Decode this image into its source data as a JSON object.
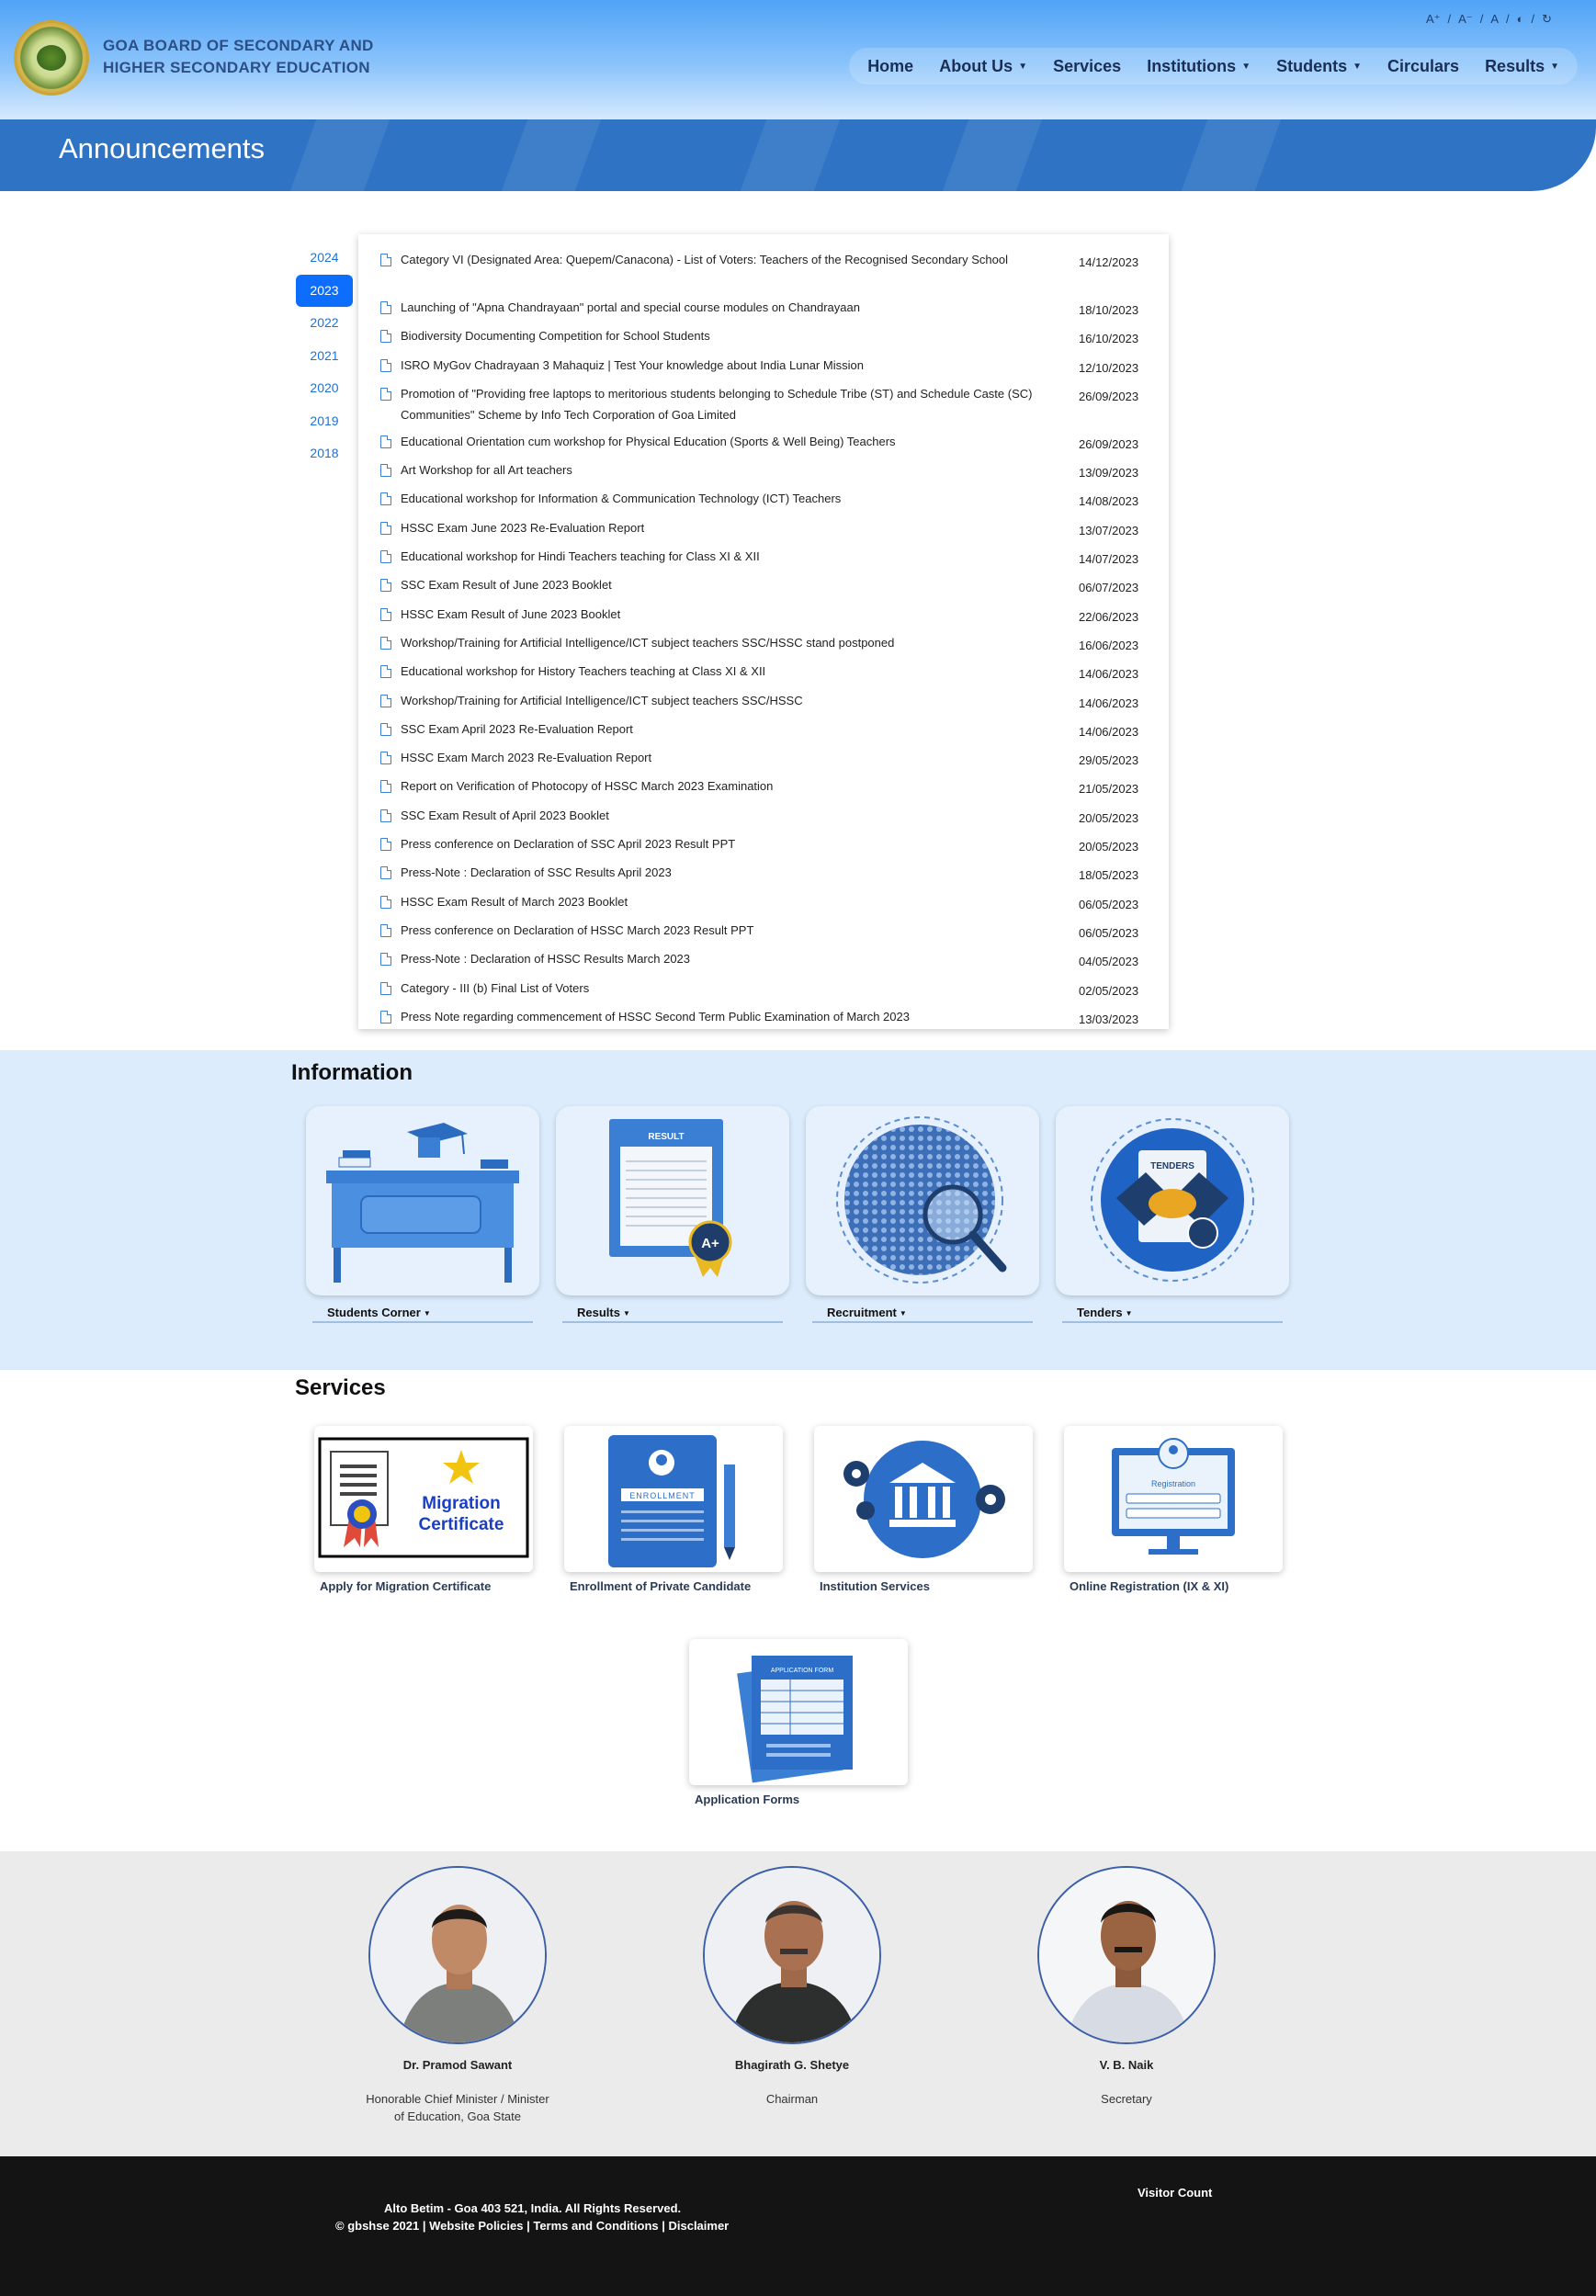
{
  "header": {
    "org_name_line1": "GOA BOARD OF SECONDARY AND",
    "org_name_line2": "HIGHER SECONDARY EDUCATION",
    "a11y": [
      "A⁺",
      "/",
      "A⁻",
      "/",
      "A",
      "/",
      "◐",
      "/",
      "↻"
    ],
    "nav": [
      {
        "label": "Home",
        "dropdown": false
      },
      {
        "label": "About Us",
        "dropdown": true
      },
      {
        "label": "Services",
        "dropdown": false
      },
      {
        "label": "Institutions",
        "dropdown": true
      },
      {
        "label": "Students",
        "dropdown": true
      },
      {
        "label": "Circulars",
        "dropdown": false
      },
      {
        "label": "Results",
        "dropdown": true
      }
    ]
  },
  "banner": {
    "title": "Announcements"
  },
  "years": [
    "2024",
    "2023",
    "2022",
    "2021",
    "2020",
    "2019",
    "2018"
  ],
  "active_year": "2023",
  "announcements": [
    {
      "text": "Category VI (Designated Area: Quepem/Canacona) - List of Voters: Teachers of the Recognised Secondary School",
      "date": "14/12/2023"
    },
    {
      "text": "Launching of \"Apna Chandrayaan\" portal and special course modules on Chandrayaan",
      "date": "18/10/2023"
    },
    {
      "text": "Biodiversity Documenting Competition for School Students",
      "date": "16/10/2023"
    },
    {
      "text": "ISRO MyGov Chadrayaan 3 Mahaquiz | Test Your knowledge about India Lunar Mission",
      "date": "12/10/2023"
    },
    {
      "text": "Promotion of \"Providing free laptops to meritorious students belonging to Schedule Tribe (ST) and Schedule Caste (SC) Communities\" Scheme by Info Tech Corporation of Goa Limited",
      "date": "26/09/2023"
    },
    {
      "text": "Educational Orientation cum workshop for Physical Education (Sports & Well Being) Teachers",
      "date": "26/09/2023"
    },
    {
      "text": "Art Workshop for all Art teachers",
      "date": "13/09/2023"
    },
    {
      "text": "Educational workshop for Information & Communication Technology (ICT) Teachers",
      "date": "14/08/2023"
    },
    {
      "text": "HSSC Exam June 2023 Re-Evaluation Report",
      "date": "13/07/2023"
    },
    {
      "text": "Educational workshop for Hindi Teachers teaching for Class XI & XII",
      "date": "14/07/2023"
    },
    {
      "text": "SSC Exam Result of June 2023 Booklet",
      "date": "06/07/2023"
    },
    {
      "text": "HSSC Exam Result of June 2023 Booklet",
      "date": "22/06/2023"
    },
    {
      "text": "Workshop/Training for Artificial Intelligence/ICT subject teachers SSC/HSSC stand postponed",
      "date": "16/06/2023"
    },
    {
      "text": "Educational workshop for History Teachers teaching at Class XI & XII",
      "date": "14/06/2023"
    },
    {
      "text": "Workshop/Training for Artificial Intelligence/ICT subject teachers SSC/HSSC",
      "date": "14/06/2023"
    },
    {
      "text": "SSC Exam April 2023 Re-Evaluation Report",
      "date": "14/06/2023"
    },
    {
      "text": "HSSC Exam March 2023 Re-Evaluation Report",
      "date": "29/05/2023"
    },
    {
      "text": "Report on Verification of Photocopy of HSSC March 2023 Examination",
      "date": "21/05/2023"
    },
    {
      "text": "SSC Exam Result of April 2023 Booklet",
      "date": "20/05/2023"
    },
    {
      "text": "Press conference on Declaration of SSC April 2023 Result PPT",
      "date": "20/05/2023"
    },
    {
      "text": "Press-Note : Declaration of SSC Results April 2023",
      "date": "18/05/2023"
    },
    {
      "text": "HSSC Exam Result of March 2023 Booklet",
      "date": "06/05/2023"
    },
    {
      "text": "Press conference on Declaration of HSSC March 2023 Result PPT",
      "date": "06/05/2023"
    },
    {
      "text": "Press-Note : Declaration of HSSC Results March 2023",
      "date": "04/05/2023"
    },
    {
      "text": "Category - III (b) Final List of Voters",
      "date": "02/05/2023"
    },
    {
      "text": "Press Note regarding commencement of HSSC Second Term Public Examination of March 2023",
      "date": "13/03/2023"
    }
  ],
  "information": {
    "title": "Information",
    "cards": [
      {
        "label": "Students Corner",
        "icon": "student-desk-icon"
      },
      {
        "label": "Results",
        "icon": "result-sheet-icon",
        "badge": "A+",
        "header": "RESULT"
      },
      {
        "label": "Recruitment",
        "icon": "crowd-magnifier-icon"
      },
      {
        "label": "Tenders",
        "icon": "tender-handshake-icon",
        "header": "TENDERS"
      }
    ]
  },
  "services": {
    "title": "Services",
    "cards": [
      {
        "label": "Apply for Migration Certificate",
        "image_text_1": "Migration",
        "image_text_2": "Certificate"
      },
      {
        "label": "Enrollment of Private Candidate",
        "image_text": "ENROLLMENT"
      },
      {
        "label": "Institution Services"
      },
      {
        "label": "Online Registration (IX & XI)",
        "image_text": "Registration"
      },
      {
        "label": "Application Forms",
        "image_text": "APPLICATION FORM"
      }
    ]
  },
  "people": [
    {
      "name": "Dr. Pramod Sawant",
      "role_line1": "Honorable Chief Minister / Minister",
      "role_line2": "of Education, Goa State"
    },
    {
      "name": "Bhagirath G. Shetye",
      "role_line1": "Chairman",
      "role_line2": ""
    },
    {
      "name": "V. B. Naik",
      "role_line1": "Secretary",
      "role_line2": ""
    }
  ],
  "footer": {
    "address": "Alto Betim - Goa 403 521, India. All Rights Reserved.",
    "copyright": "© gbshse 2021 | ",
    "links": [
      "Website Policies",
      "Terms and Conditions",
      "Disclaimer"
    ],
    "visitor_count_label": "Visitor Count"
  },
  "colors": {
    "primary": "#0d6efd",
    "banner": "#2f73c4",
    "info_bg": "#dcecfc",
    "footer": "#141414"
  }
}
